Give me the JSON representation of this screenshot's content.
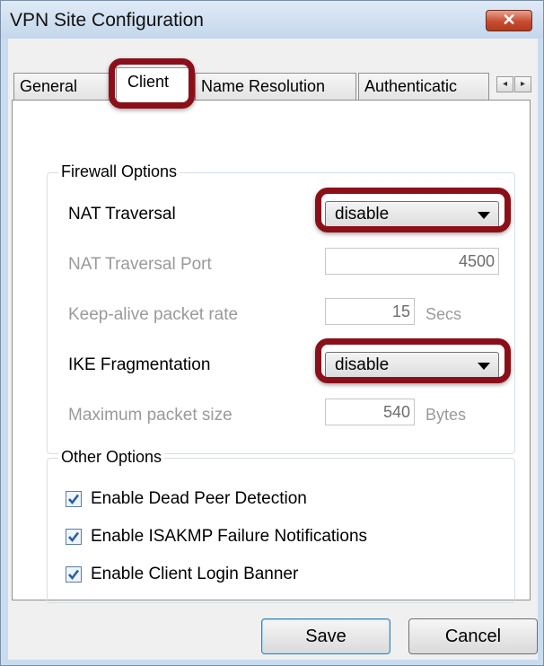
{
  "window": {
    "title": "VPN Site Configuration",
    "close_glyph": "✕"
  },
  "tabs": [
    {
      "label": "General",
      "active": false
    },
    {
      "label": "Client",
      "active": true
    },
    {
      "label": "Name Resolution",
      "active": false
    },
    {
      "label": "Authenticatic",
      "active": false
    }
  ],
  "tab_scroll": {
    "left_glyph": "◂",
    "right_glyph": "▸"
  },
  "firewall": {
    "group_label": "Firewall Options",
    "nat_traversal": {
      "label": "NAT Traversal",
      "value": "disable"
    },
    "nat_traversal_port": {
      "label": "NAT Traversal Port",
      "value": "4500"
    },
    "keep_alive": {
      "label": "Keep-alive packet rate",
      "value": "15",
      "unit": "Secs"
    },
    "ike_fragmentation": {
      "label": "IKE Fragmentation",
      "value": "disable"
    },
    "max_packet": {
      "label": "Maximum packet size",
      "value": "540",
      "unit": "Bytes"
    }
  },
  "other": {
    "group_label": "Other Options",
    "options": [
      {
        "label": "Enable Dead Peer Detection",
        "checked": true
      },
      {
        "label": "Enable ISAKMP Failure Notifications",
        "checked": true
      },
      {
        "label": "Enable Client Login Banner",
        "checked": true
      }
    ]
  },
  "buttons": {
    "save": "Save",
    "cancel": "Cancel"
  },
  "colors": {
    "highlight": "#8b0f19",
    "check": "#2a5da8"
  }
}
